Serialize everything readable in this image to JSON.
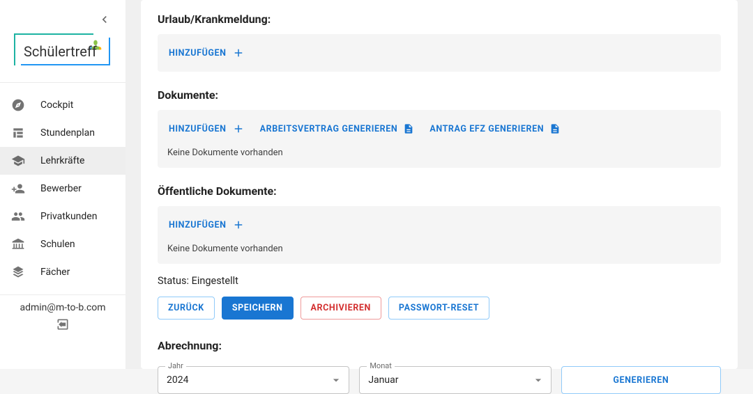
{
  "brand": {
    "name": "Schülertreff"
  },
  "sidebar": {
    "items": [
      {
        "label": "Cockpit"
      },
      {
        "label": "Stundenplan"
      },
      {
        "label": "Lehrkräfte"
      },
      {
        "label": "Bewerber"
      },
      {
        "label": "Privatkunden"
      },
      {
        "label": "Schulen"
      },
      {
        "label": "Fächer"
      }
    ],
    "active_index": 2,
    "user_email": "admin@m-to-b.com"
  },
  "section_vacation": {
    "title": "Urlaub/Krankmeldung:",
    "add_label": "Hinzufügen"
  },
  "section_documents": {
    "title": "Dokumente:",
    "add_label": "Hinzufügen",
    "generate_contract_label": "Arbeitsvertrag generieren",
    "generate_efz_label": "Antrag EFZ generieren",
    "empty_text": "Keine Dokumente vorhanden"
  },
  "section_public_documents": {
    "title": "Öffentliche Dokumente:",
    "add_label": "Hinzufügen",
    "empty_text": "Keine Dokumente vorhanden"
  },
  "status": {
    "label": "Status:",
    "value": "Eingestellt"
  },
  "actions": {
    "back": "Zurück",
    "save": "Speichern",
    "archive": "Archivieren",
    "password_reset": "Passwort-Reset"
  },
  "billing": {
    "title": "Abrechnung:",
    "year_label": "Jahr",
    "year_value": "2024",
    "month_label": "Monat",
    "month_value": "Januar",
    "generate_label": "Generieren"
  }
}
